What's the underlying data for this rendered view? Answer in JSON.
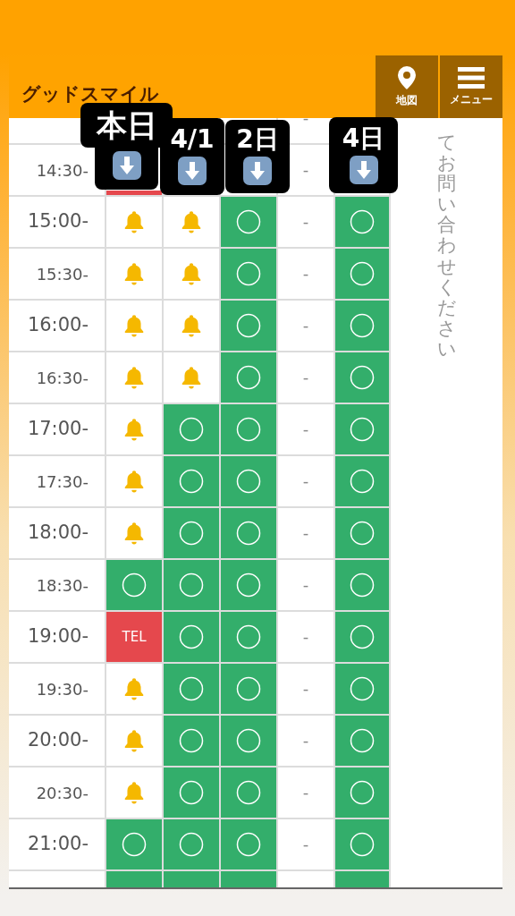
{
  "header": {
    "title": "グッドスマイル",
    "buttons": [
      {
        "kind": "map",
        "label": "地図"
      },
      {
        "kind": "menu",
        "label": "メニュー"
      }
    ]
  },
  "day_labels": [
    {
      "label": "本日"
    },
    {
      "label": "4/1"
    },
    {
      "label": "2日"
    },
    {
      "label": "4日"
    }
  ],
  "note": "てお問い合わせください",
  "rows": [
    {
      "cells": [
        {
          "kind": "empty"
        },
        {
          "kind": "empty"
        },
        {
          "kind": "empty"
        },
        {
          "kind": "dash",
          "text": "-"
        },
        {
          "kind": "empty"
        }
      ]
    },
    {
      "time": "14:30-",
      "cells": [
        {
          "kind": "red"
        },
        {
          "kind": "empty"
        },
        {
          "kind": "empty"
        },
        {
          "kind": "dash",
          "text": "-"
        },
        {
          "kind": "empty"
        }
      ]
    },
    {
      "time": "15:00-",
      "cells": [
        {
          "kind": "bell"
        },
        {
          "kind": "bell"
        },
        {
          "kind": "circle"
        },
        {
          "kind": "dash",
          "text": "-"
        },
        {
          "kind": "circle"
        }
      ]
    },
    {
      "time": "15:30-",
      "cells": [
        {
          "kind": "bell"
        },
        {
          "kind": "bell"
        },
        {
          "kind": "circle"
        },
        {
          "kind": "dash",
          "text": "-"
        },
        {
          "kind": "circle"
        }
      ]
    },
    {
      "time": "16:00-",
      "cells": [
        {
          "kind": "bell"
        },
        {
          "kind": "bell"
        },
        {
          "kind": "circle"
        },
        {
          "kind": "dash",
          "text": "-"
        },
        {
          "kind": "circle"
        }
      ]
    },
    {
      "time": "16:30-",
      "cells": [
        {
          "kind": "bell"
        },
        {
          "kind": "bell"
        },
        {
          "kind": "circle"
        },
        {
          "kind": "dash",
          "text": "-"
        },
        {
          "kind": "circle"
        }
      ]
    },
    {
      "time": "17:00-",
      "cells": [
        {
          "kind": "bell"
        },
        {
          "kind": "circle"
        },
        {
          "kind": "circle"
        },
        {
          "kind": "dash",
          "text": "-"
        },
        {
          "kind": "circle"
        }
      ]
    },
    {
      "time": "17:30-",
      "cells": [
        {
          "kind": "bell"
        },
        {
          "kind": "circle"
        },
        {
          "kind": "circle"
        },
        {
          "kind": "dash",
          "text": "-"
        },
        {
          "kind": "circle"
        }
      ]
    },
    {
      "time": "18:00-",
      "cells": [
        {
          "kind": "bell"
        },
        {
          "kind": "circle"
        },
        {
          "kind": "circle"
        },
        {
          "kind": "dash",
          "text": "-"
        },
        {
          "kind": "circle"
        }
      ]
    },
    {
      "time": "18:30-",
      "cells": [
        {
          "kind": "circle"
        },
        {
          "kind": "circle"
        },
        {
          "kind": "circle"
        },
        {
          "kind": "dash",
          "text": "-"
        },
        {
          "kind": "circle"
        }
      ]
    },
    {
      "time": "19:00-",
      "cells": [
        {
          "kind": "tel",
          "text": "TEL"
        },
        {
          "kind": "circle"
        },
        {
          "kind": "circle"
        },
        {
          "kind": "dash",
          "text": "-"
        },
        {
          "kind": "circle"
        }
      ]
    },
    {
      "time": "19:30-",
      "cells": [
        {
          "kind": "bell"
        },
        {
          "kind": "circle"
        },
        {
          "kind": "circle"
        },
        {
          "kind": "dash",
          "text": "-"
        },
        {
          "kind": "circle"
        }
      ]
    },
    {
      "time": "20:00-",
      "cells": [
        {
          "kind": "bell"
        },
        {
          "kind": "circle"
        },
        {
          "kind": "circle"
        },
        {
          "kind": "dash",
          "text": "-"
        },
        {
          "kind": "circle"
        }
      ]
    },
    {
      "time": "20:30-",
      "cells": [
        {
          "kind": "bell"
        },
        {
          "kind": "circle"
        },
        {
          "kind": "circle"
        },
        {
          "kind": "dash",
          "text": "-"
        },
        {
          "kind": "circle"
        }
      ]
    },
    {
      "time": "21:00-",
      "cells": [
        {
          "kind": "circle"
        },
        {
          "kind": "circle"
        },
        {
          "kind": "circle"
        },
        {
          "kind": "dash",
          "text": "-"
        },
        {
          "kind": "circle"
        }
      ]
    },
    {
      "cells": [
        {
          "kind": "green"
        },
        {
          "kind": "green"
        },
        {
          "kind": "green"
        },
        {
          "kind": "empty"
        },
        {
          "kind": "green"
        }
      ]
    }
  ]
}
